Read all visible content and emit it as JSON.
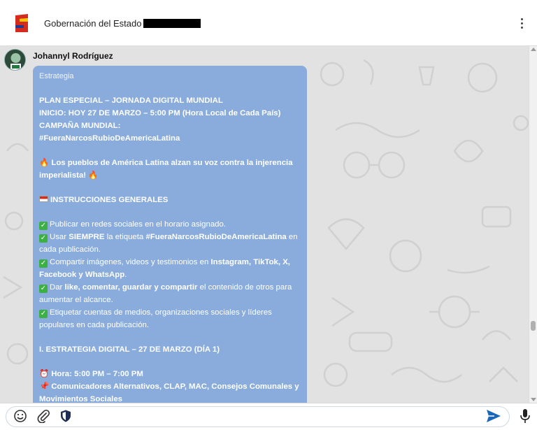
{
  "header": {
    "title": "Gobernación del Estado",
    "menu_icon": "kebab-menu-icon",
    "logo_icon": "state-logo-icon",
    "colors": {
      "logo_red": "#d52b1e",
      "logo_blue": "#1f3b8f",
      "logo_yellow": "#f5c400"
    }
  },
  "message": {
    "sender": "Johannyl Rodríguez",
    "tag": "Estrategia",
    "bubble_color": "#89acdc",
    "lines": {
      "h1": "PLAN ESPECIAL – JORNADA DIGITAL MUNDIAL",
      "h2": "INICIO: HOY 27 DE MARZO – 5:00 PM (Hora Local de Cada País)",
      "h3": "CAMPAÑA MUNDIAL:",
      "h4": "#FueraNarcosRubioDeAmericaLatina",
      "intro": "Los pueblos de América Latina alzan su voz contra la injerencia imperialista!",
      "section1": "INSTRUCCIONES GENERALES",
      "i1": "Publicar en redes sociales en el horario asignado.",
      "i2_a": "Usar",
      "i2_b": "SIEMPRE",
      "i2_c": "la etiqueta",
      "i2_d": "#FueraNarcosRubioDeAmericaLatina",
      "i2_e": "en cada publicación.",
      "i3_a": "Compartir imágenes, videos y testimonios en",
      "i3_b": "Instagram, TikTok, X, Facebook y WhatsApp",
      "i3_c": ".",
      "i4_a": "Dar",
      "i4_b": "like, comentar, guardar y compartir",
      "i4_c": "el contenido de otros para aumentar el alcance.",
      "i5": "Etiquetar cuentas de medios, organizaciones sociales y líderes populares en cada publicación.",
      "section2": "I. ESTRATEGIA DIGITAL – 27 DE MARZO (DÍA 1)",
      "hora": "Hora: 5:00 PM – 7:00 PM",
      "grupo": "Comunicadores Alternativos, CLAP, MAC, Consejos Comunales y Movimientos Sociales"
    }
  },
  "composer": {
    "placeholder": "",
    "icons": [
      "emoji-icon",
      "attachment-icon",
      "shield-icon",
      "send-icon",
      "microphone-icon"
    ],
    "send_color": "#1a66b8"
  }
}
